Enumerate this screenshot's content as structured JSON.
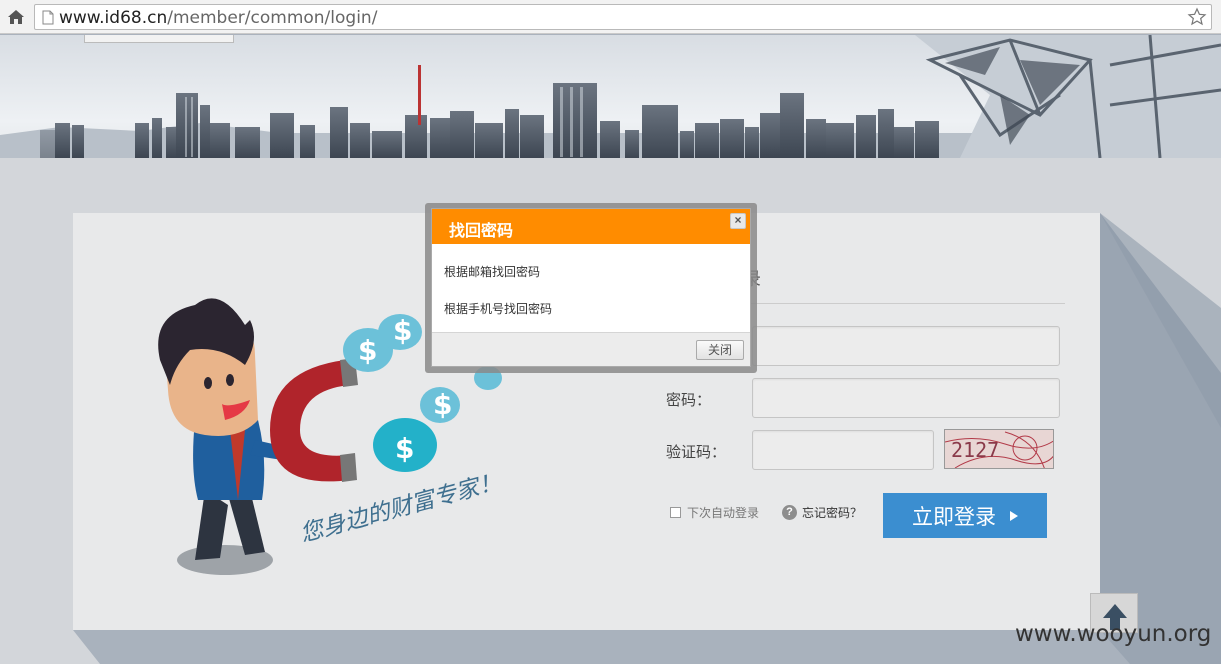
{
  "browser": {
    "url_domain": "www.id68.cn",
    "url_path": "/member/common/login/"
  },
  "login": {
    "title_partial": "录",
    "password_label": "密码：",
    "captcha_label": "验证码：",
    "captcha_text": "2127",
    "auto_login_label": "下次自动登录",
    "forgot_label": "忘记密码？",
    "submit_label": "立即登录",
    "slogan": "您身边的财富专家！"
  },
  "modal": {
    "title": "找回密码",
    "close_x": "×",
    "options": [
      "根据邮箱找回密码",
      "根据手机号找回密码"
    ],
    "close_button_label": "关闭"
  },
  "watermark": "www.wooyun.org",
  "colors": {
    "modal_header": "#ff8c00",
    "login_button": "#3b8ed0"
  },
  "icons": [
    "home-icon",
    "page-icon",
    "star-icon",
    "help-icon",
    "arrow-up-icon"
  ]
}
